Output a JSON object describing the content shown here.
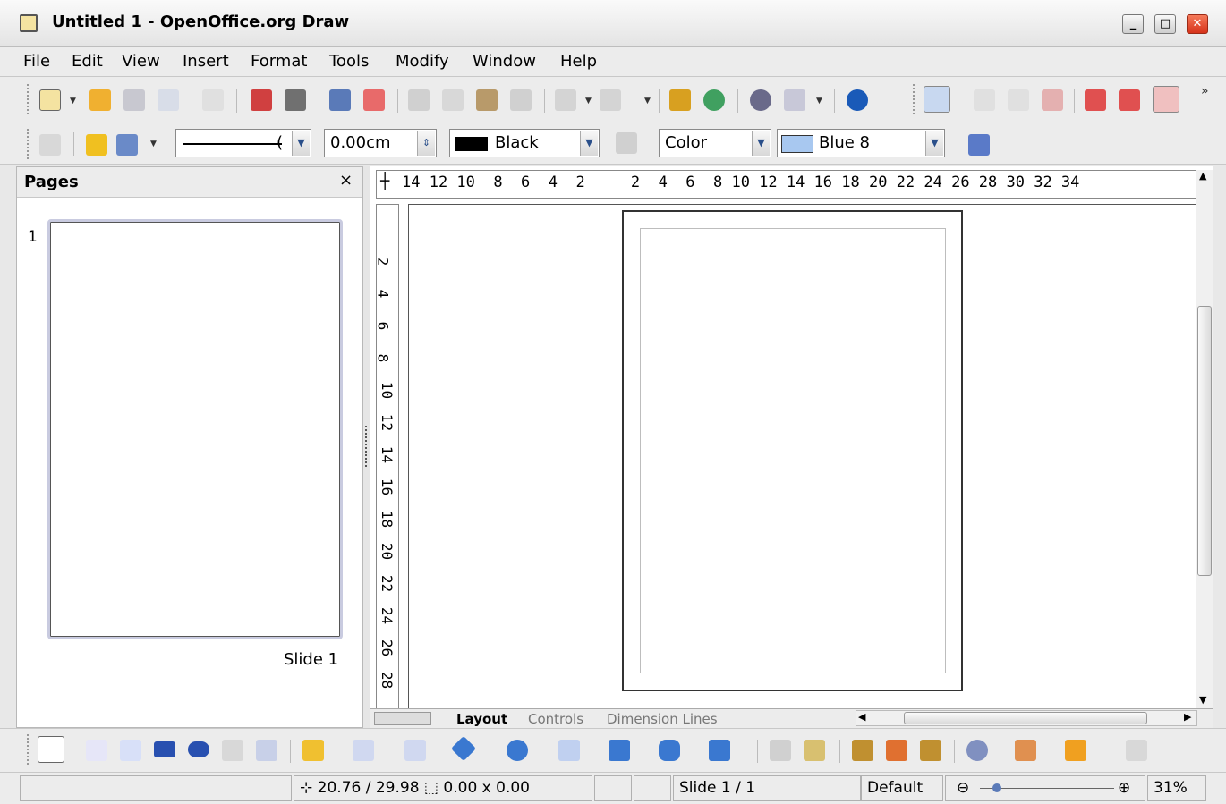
{
  "window": {
    "title": "Untitled 1 - OpenOffice.org Draw"
  },
  "menu": [
    "File",
    "Edit",
    "View",
    "Insert",
    "Format",
    "Tools",
    "Modify",
    "Window",
    "Help"
  ],
  "line_toolbar": {
    "line_style_value": "(",
    "line_width": "0.00cm",
    "line_color": "Black",
    "area_style": "Color",
    "area_color": "Blue 8",
    "line_color_hex": "#000000",
    "area_color_hex": "#a8c8f0"
  },
  "pages_panel": {
    "title": "Pages",
    "close": "×",
    "slides": [
      {
        "number": "1",
        "label": "Slide 1"
      }
    ]
  },
  "h_ruler": "14 12 10  8  6  4  2     2  4  6  8 10 12 14 16 18 20 22 24 26 28 30 32 34",
  "v_ruler": [
    "2",
    "4",
    "6",
    "8",
    "10",
    "12",
    "14",
    "16",
    "18",
    "20",
    "22",
    "24",
    "26",
    "28"
  ],
  "tabs": [
    "Layout",
    "Controls",
    "Dimension Lines"
  ],
  "status": {
    "position": "20.76 / 29.98",
    "size": "0.00 x 0.00",
    "slide": "Slide 1 / 1",
    "layout": "Default",
    "zoom": "31%"
  }
}
